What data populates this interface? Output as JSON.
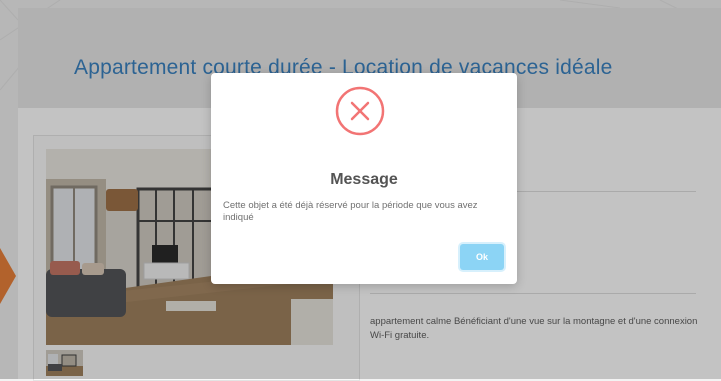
{
  "page": {
    "title": "Appartement courte durée - Location de vacances idéale",
    "description": "appartement calme Bénéficiant d'une vue sur la montagne et d'une connexion Wi-Fi gratuite."
  },
  "modal": {
    "icon": "error-x-circle-icon",
    "title": "Message",
    "text": "Cette objet a été déjà réservé pour la période que vous avez indiqué",
    "ok_label": "Ok"
  },
  "colors": {
    "title_blue": "#2f7bbd",
    "error_red": "#f27474",
    "ok_blue": "#8cd4f5",
    "accent_orange": "#e8792e"
  }
}
